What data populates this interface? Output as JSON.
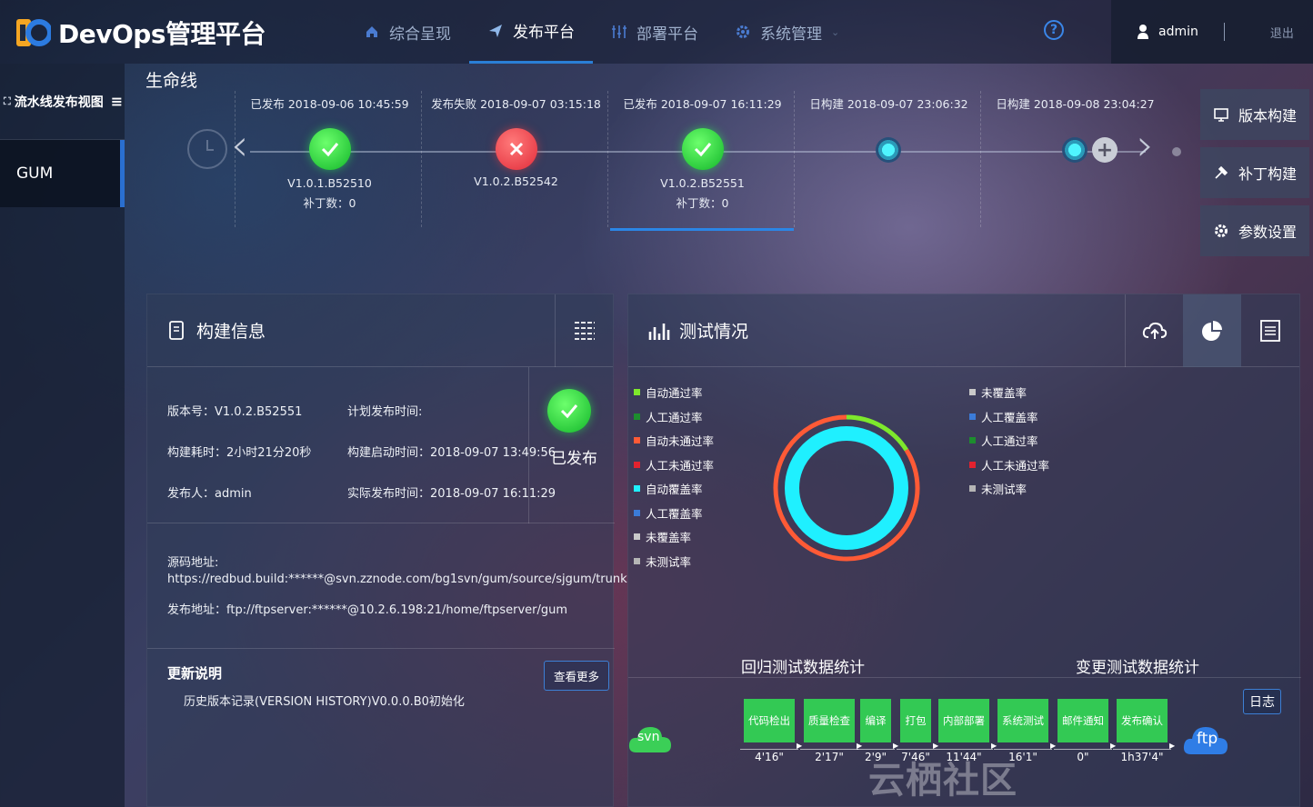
{
  "app": {
    "title": "DevOps管理平台"
  },
  "nav": [
    {
      "label": "综合呈现",
      "icon": "home-icon"
    },
    {
      "label": "发布平台",
      "icon": "send-icon",
      "active": true
    },
    {
      "label": "部署平台",
      "icon": "deploy-icon"
    },
    {
      "label": "系统管理",
      "icon": "gear-icon"
    }
  ],
  "user": {
    "name": "admin",
    "logout": "退出"
  },
  "sidebar": {
    "title": "流水线发布视图",
    "items": [
      {
        "label": "GUM"
      }
    ]
  },
  "lifecycle": {
    "title": "生命线",
    "nodes": [
      {
        "caption": "已发布   2018-09-06 10:45:59",
        "version": "V1.0.1.B52510",
        "patches": "补丁数：0",
        "status": "ok"
      },
      {
        "caption": "发布失败   2018-09-07 03:15:18",
        "version": "V1.0.2.B52542",
        "patches": "",
        "status": "fail"
      },
      {
        "caption": "已发布   2018-09-07 16:11:29",
        "version": "V1.0.2.B52551",
        "patches": "补丁数：0",
        "status": "ok"
      },
      {
        "caption": "日构建   2018-09-07 23:06:32",
        "version": "",
        "patches": "",
        "status": "dot"
      },
      {
        "caption": "日构建   2018-09-08 23:04:27",
        "version": "",
        "patches": "",
        "status": "dot"
      }
    ]
  },
  "actions": {
    "build": "版本构建",
    "patch": "补丁构建",
    "params": "参数设置"
  },
  "build_info": {
    "title": "构建信息",
    "version": "版本号：V1.0.2.B52551",
    "plan_time": "计划发布时间:",
    "duration": "构建耗时：2小时21分20秒",
    "start_time": "构建启动时间：2018-09-07 13:49:56",
    "publisher": "发布人：admin",
    "actual_time": "实际发布时间：2018-09-07 16:11:29",
    "status": "已发布",
    "source_label": "源码地址:",
    "source_url": "https://redbud.build:******@svn.zznode.com/bg1svn/gum/source/sjgum/trunk",
    "publish_addr": "发布地址：ftp://ftpserver:******@10.2.6.198:21/home/ftpserver/gum",
    "update_title": "更新说明",
    "more": "查看更多",
    "history": "历史版本记录(VERSION HISTORY)V0.0.0.B0初始化"
  },
  "test": {
    "title": "测试情况",
    "legend_left": [
      {
        "label": "自动通过率",
        "color": "#7ee82c"
      },
      {
        "label": "人工通过率",
        "color": "#1d8d2e"
      },
      {
        "label": "自动未通过率",
        "color": "#ff5a36"
      },
      {
        "label": "人工未通过率",
        "color": "#e2222f"
      },
      {
        "label": "自动覆盖率",
        "color": "#1ff0ff"
      },
      {
        "label": "人工覆盖率",
        "color": "#3b7bd8"
      },
      {
        "label": "未覆盖率",
        "color": "#c9c9c9"
      },
      {
        "label": "未测试率",
        "color": "#b5b5b5"
      }
    ],
    "legend_right": [
      {
        "label": "未覆盖率",
        "color": "#c9c9c9"
      },
      {
        "label": "人工覆盖率",
        "color": "#3b7bd8"
      },
      {
        "label": "人工通过率",
        "color": "#1d8d2e"
      },
      {
        "label": "人工未通过率",
        "color": "#e2222f"
      },
      {
        "label": "未测试率",
        "color": "#b5b5b5"
      }
    ],
    "regression_title": "回归测试数据统计",
    "change_title": "变更测试数据统计",
    "log": "日志"
  },
  "chart_data": {
    "type": "pie",
    "rings": [
      {
        "name": "",
        "slices": [
          {
            "label": "自动通过率",
            "value": 16
          },
          {
            "label": "自动未通过率",
            "value": 84
          }
        ]
      },
      {
        "name": "",
        "slices": [
          {
            "label": "自动覆盖率",
            "value": 100
          }
        ]
      }
    ]
  },
  "pipeline": {
    "start": "svn",
    "end": "ftp",
    "stages": [
      {
        "label": "代码检出",
        "time": "4'16\""
      },
      {
        "label": "质量检查",
        "time": "2'17\""
      },
      {
        "label": "编译",
        "time": "2'9\""
      },
      {
        "label": "打包",
        "time": "7'46\""
      },
      {
        "label": "内部部署",
        "time": "11'44\""
      },
      {
        "label": "系统测试",
        "time": "16'1\""
      },
      {
        "label": "邮件通知",
        "time": "0\""
      },
      {
        "label": "发布确认",
        "time": "1h37'4\""
      }
    ]
  },
  "watermark": "云栖社区 yq.aliyun.com"
}
